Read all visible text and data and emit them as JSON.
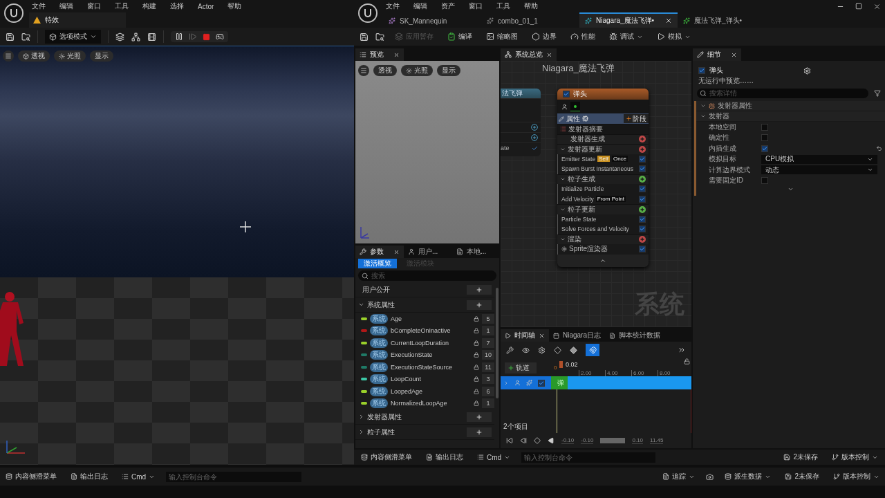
{
  "main_editor": {
    "menu": [
      "文件",
      "编辑",
      "窗口",
      "工具",
      "构建",
      "选择",
      "Actor",
      "帮助"
    ],
    "level_tab": "特效",
    "mode_button": "选项模式",
    "viewport_buttons": [
      "透视",
      "光照",
      "显示"
    ]
  },
  "niagara": {
    "menu": [
      "文件",
      "编辑",
      "资产",
      "窗口",
      "工具",
      "帮助"
    ],
    "tabs": [
      {
        "label": "SK_Mannequin",
        "selected": false
      },
      {
        "label": "combo_01_1",
        "selected": false
      },
      {
        "label": "Niagara_魔法飞弹•",
        "selected": true
      },
      {
        "label": "魔法飞弹_弹头•",
        "selected": false
      }
    ],
    "toolbar": [
      {
        "label": "应用暂存",
        "disabled": true
      },
      {
        "label": "编译",
        "disabled": false
      },
      {
        "label": "缩略图",
        "disabled": false
      },
      {
        "label": "边界",
        "disabled": false
      },
      {
        "label": "性能",
        "disabled": false
      },
      {
        "label": "调试",
        "disabled": false
      },
      {
        "label": "模拟",
        "disabled": false
      }
    ],
    "preview": {
      "tab": "预览",
      "buttons": [
        "透视",
        "光照",
        "显示"
      ]
    },
    "params": {
      "tabs": [
        {
          "label": "参数",
          "selected": true
        },
        {
          "label": "用户...",
          "selected": false
        },
        {
          "label": "本地...",
          "selected": false
        }
      ],
      "filters": [
        {
          "label": "激活概览",
          "selected": true
        },
        {
          "label": "激活模块",
          "selected": false
        }
      ],
      "search_placeholder": "搜索",
      "user_exposed": "用户公开",
      "groups": [
        {
          "label": "系统属性",
          "expanded": true,
          "params": [
            {
              "tag": "系统",
              "name": "Age",
              "count": "5",
              "color": "#9ad02a"
            },
            {
              "tag": "系统",
              "name": "bCompleteOnInactive",
              "count": "1",
              "color": "#b01818"
            },
            {
              "tag": "系统",
              "name": "CurrentLoopDuration",
              "count": "7",
              "color": "#9ad02a"
            },
            {
              "tag": "系统",
              "name": "ExecutionState",
              "count": "10",
              "color": "#1f7a66"
            },
            {
              "tag": "系统",
              "name": "ExecutionStateSource",
              "count": "11",
              "color": "#1f7a66"
            },
            {
              "tag": "系统",
              "name": "LoopCount",
              "count": "3",
              "color": "#3cc8a6"
            },
            {
              "tag": "系统",
              "name": "LoopedAge",
              "count": "6",
              "color": "#9ad02a"
            },
            {
              "tag": "系统",
              "name": "NormalizedLoopAge",
              "count": "1",
              "color": "#9ad02a"
            }
          ]
        },
        {
          "label": "发射器属性",
          "expanded": false
        },
        {
          "label": "粒子属性",
          "expanded": false
        }
      ]
    },
    "overview": {
      "tab": "系统总览",
      "title": "Niagara_魔法飞弹",
      "watermark": "系统",
      "side_node": {
        "title": "法飞弹",
        "row": "ate"
      },
      "emitter": {
        "name": "弹头",
        "enabled": true,
        "properties_label": "属性",
        "stage_button": "阶段",
        "summary": "发射器摘要",
        "groups": [
          {
            "label": "发射器生成",
            "color": "#c04848"
          },
          {
            "label": "发射器更新",
            "color": "#c04848",
            "modules": [
              {
                "kind": "module",
                "name": "Emitter State",
                "enabled": true,
                "tags": [
                  {
                    "label": "Self",
                    "highlighted": true
                  },
                  {
                    "label": "Once",
                    "highlighted": false
                  }
                ]
              },
              {
                "kind": "module",
                "name": "Spawn Burst Instantaneous",
                "enabled": true
              }
            ]
          },
          {
            "label": "粒子生成",
            "color": "#58b048",
            "modules": [
              {
                "kind": "module",
                "name": "Initialize Particle",
                "enabled": true
              },
              {
                "kind": "module",
                "name": "Add Velocity",
                "enabled": true,
                "tags": [
                  {
                    "label": "From Point",
                    "highlighted": false
                  }
                ]
              }
            ]
          },
          {
            "label": "粒子更新",
            "color": "#58b048",
            "modules": [
              {
                "kind": "module",
                "name": "Particle State",
                "enabled": true
              },
              {
                "kind": "module",
                "name": "Solve Forces and Velocity",
                "enabled": true
              }
            ]
          },
          {
            "label": "渲染",
            "color": "#c04848",
            "modules": [
              {
                "kind": "renderer",
                "name": "Sprite渲染器",
                "enabled": true
              }
            ]
          }
        ]
      }
    },
    "timeline": {
      "tabs": [
        {
          "label": "时间轴",
          "selected": true
        },
        {
          "label": "Niagara日志",
          "selected": false
        },
        {
          "label": "脚本统计数据",
          "selected": false
        }
      ],
      "snap_on": true,
      "add_track": "轨道",
      "start": "0",
      "playhead": "0.02",
      "ticks": [
        "2.00",
        "4.00",
        "6.00",
        "8.00"
      ],
      "track_label": "弹",
      "track_enabled": true,
      "item_count": "2个项目",
      "times": [
        "-0.10",
        "-0.10",
        "0.10",
        "11.45"
      ]
    },
    "details": {
      "tab": "细节",
      "emitter_name": "弹头",
      "enabled": true,
      "status": "无运行中预览……",
      "search_placeholder": "搜索详情",
      "section": "发射器属性",
      "category": "发射器",
      "rows": [
        {
          "kind": "checkbox",
          "label": "本地空间",
          "checked": false
        },
        {
          "kind": "checkbox",
          "label": "确定性",
          "checked": false
        },
        {
          "kind": "checkbox",
          "label": "内插生成",
          "checked": true
        },
        {
          "kind": "dropdown",
          "label": "模拟目标",
          "value": "CPU模拟"
        },
        {
          "kind": "dropdown",
          "label": "计算边界模式",
          "value": "动态"
        },
        {
          "kind": "checkbox",
          "label": "需要固定ID",
          "checked": false
        }
      ]
    },
    "bottom_bar": {
      "content_drawer": "内容侧滑菜单",
      "output_log": "输出日志",
      "cmd": "Cmd",
      "console_placeholder": "输入控制台命令",
      "unsaved": "2未保存",
      "source_control": "版本控制"
    }
  },
  "status_bar": {
    "content_drawer": "内容侧滑菜单",
    "output_log": "输出日志",
    "cmd": "Cmd",
    "console_placeholder": "输入控制台命令",
    "trace": "追踪",
    "derived_data": "派生数据",
    "unsaved": "2未保存",
    "source_control": "版本控制"
  }
}
